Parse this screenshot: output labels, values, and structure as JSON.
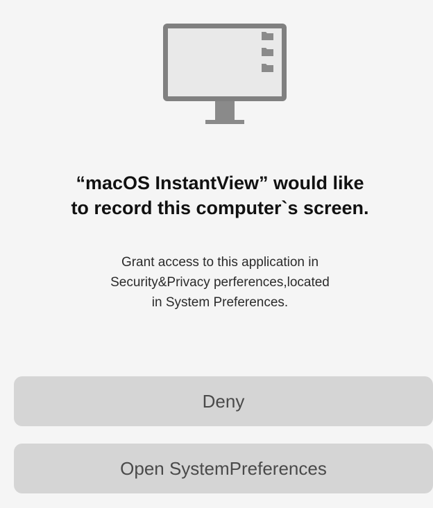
{
  "dialog": {
    "icon": "monitor-icon",
    "title_lines": [
      "“macOS InstantView” would like",
      "to record this computer`s screen."
    ],
    "message_lines": [
      "Grant access to this application in",
      "Security&Privacy perferences,located",
      "in System Preferences."
    ],
    "buttons": {
      "deny_label": "Deny",
      "open_label": "Open SystemPreferences"
    }
  },
  "colors": {
    "background": "#f5f5f5",
    "button_fill": "#d5d5d5",
    "icon_gray": "#808080",
    "icon_screen": "#e9e9e9"
  }
}
